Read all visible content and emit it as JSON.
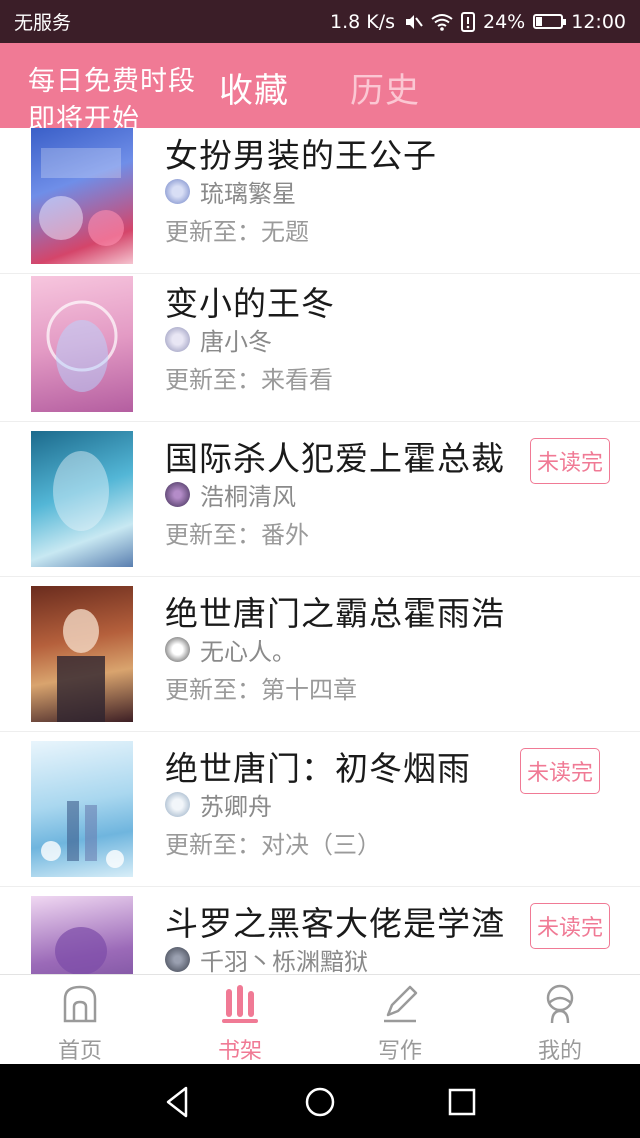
{
  "status_bar": {
    "carrier": "无服务",
    "speed": "1.8 K/s",
    "battery_percent": "24%",
    "battery_level": 0.24,
    "time": "12:00"
  },
  "header": {
    "promo_text": "每日免费时段即将开始",
    "tabs": [
      {
        "label": "收藏",
        "active": true
      },
      {
        "label": "历史",
        "active": false
      }
    ]
  },
  "books": [
    {
      "title": "女扮男装的王公子",
      "author": "琉璃繁星",
      "update": "更新至：无题",
      "unread": false
    },
    {
      "title": "变小的王冬",
      "author": "唐小冬",
      "update": "更新至：来看看",
      "unread": false
    },
    {
      "title": "国际杀人犯爱上霍总裁",
      "author": "浩桐清风",
      "update": "更新至：番外",
      "unread": true
    },
    {
      "title": "绝世唐门之霸总霍雨浩",
      "author": "无心人。",
      "update": "更新至：第十四章",
      "unread": false
    },
    {
      "title": "绝世唐门：初冬烟雨",
      "author": "苏卿舟",
      "update": "更新至：对决（三）",
      "unread": true
    },
    {
      "title": "斗罗之黑客大佬是学渣",
      "author": "千羽丶栎渊黯狱",
      "update": "",
      "unread": true
    }
  ],
  "unread_label": "未读完",
  "bottom_nav": [
    {
      "label": "首页",
      "icon": "home-icon",
      "active": false
    },
    {
      "label": "书架",
      "icon": "bookshelf-icon",
      "active": true
    },
    {
      "label": "写作",
      "icon": "pencil-icon",
      "active": false
    },
    {
      "label": "我的",
      "icon": "profile-icon",
      "active": false
    }
  ],
  "colors": {
    "accent": "#f07a95",
    "status_bar": "#3b1e28"
  }
}
